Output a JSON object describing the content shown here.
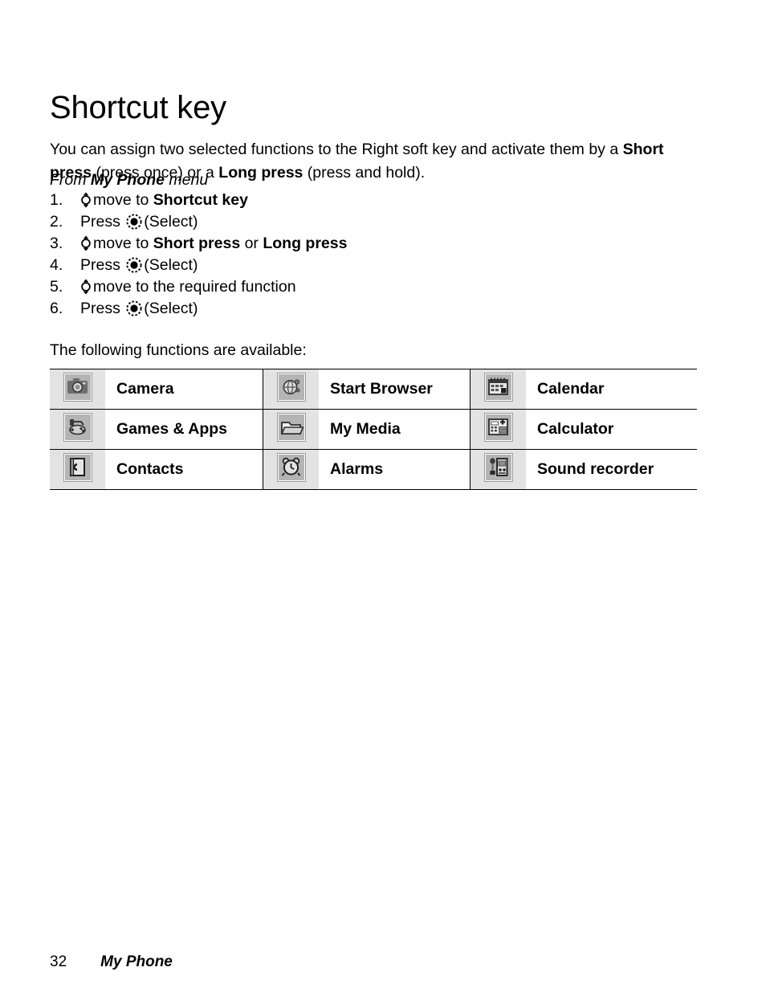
{
  "document": {
    "title": "Shortcut key",
    "intro_part1": "You can assign two selected functions to the Right soft key and activate them by a ",
    "intro_bold1": "Short press",
    "intro_part2": " (press once) or a ",
    "intro_bold2": "Long press",
    "intro_part3": " (press and hold).",
    "from_prefix": "From ",
    "from_bold": "My Phone",
    "from_suffix": " menu",
    "available_line": "The following functions are available:"
  },
  "steps": [
    {
      "number": "1.",
      "icon": "nav-updown-key-icon",
      "text_before": "move to ",
      "bold1": "Shortcut key",
      "middle": "",
      "bold2": "",
      "text_after": ""
    },
    {
      "number": "2.",
      "icon": "select-key-icon",
      "text_before": "Press ",
      "bold1": "",
      "middle": "",
      "bold2": "",
      "text_after": "(Select)"
    },
    {
      "number": "3.",
      "icon": "nav-updown-key-icon",
      "text_before": "move to ",
      "bold1": "Short press",
      "middle": " or ",
      "bold2": "Long press",
      "text_after": ""
    },
    {
      "number": "4.",
      "icon": "select-key-icon",
      "text_before": "Press ",
      "bold1": "",
      "middle": "",
      "bold2": "",
      "text_after": "(Select)"
    },
    {
      "number": "5.",
      "icon": "nav-updown-key-icon",
      "text_before": "move to the required function",
      "bold1": "",
      "middle": "",
      "bold2": "",
      "text_after": ""
    },
    {
      "number": "6.",
      "icon": "select-key-icon",
      "text_before": "Press ",
      "bold1": "",
      "middle": "",
      "bold2": "",
      "text_after": "(Select)"
    }
  ],
  "functions_table": {
    "rows": [
      [
        {
          "icon": "camera-icon",
          "label": "Camera"
        },
        {
          "icon": "globe-browser-icon",
          "label": "Start Browser"
        },
        {
          "icon": "calendar-icon",
          "label": "Calendar"
        }
      ],
      [
        {
          "icon": "games-apps-icon",
          "label": "Games & Apps"
        },
        {
          "icon": "folder-icon",
          "label": "My Media"
        },
        {
          "icon": "calculator-icon",
          "label": "Calculator"
        }
      ],
      [
        {
          "icon": "contacts-icon",
          "label": "Contacts"
        },
        {
          "icon": "alarm-clock-icon",
          "label": "Alarms"
        },
        {
          "icon": "sound-recorder-icon",
          "label": "Sound recorder"
        }
      ]
    ]
  },
  "footer": {
    "page_number": "32",
    "section": "My Phone"
  },
  "colors": {
    "text": "#000000",
    "page_background": "#ffffff",
    "icon_cell_background": "#e3e3e3",
    "icon_tile_fill": "#b4b4b4",
    "rule": "#000000"
  }
}
